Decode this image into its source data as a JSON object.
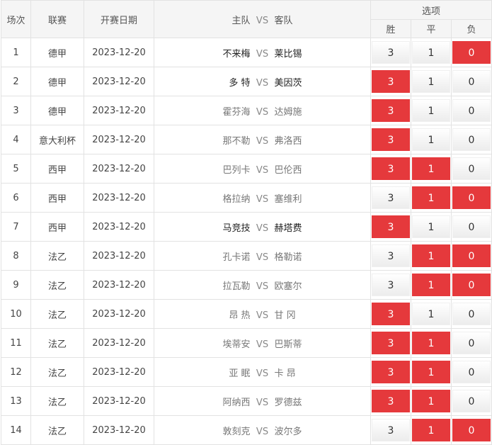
{
  "headers": {
    "index": "场次",
    "league": "联赛",
    "date": "开赛日期",
    "home": "主队",
    "vs": "VS",
    "away": "客队",
    "options": "选项",
    "win": "胜",
    "draw": "平",
    "lose": "负"
  },
  "colors": {
    "selected": "#e5393c"
  },
  "matches": [
    {
      "no": "1",
      "league": "德甲",
      "date": "2023-12-20",
      "home": "不来梅",
      "away": "莱比锡",
      "win": "3",
      "draw": "1",
      "lose": "0",
      "sel": [
        false,
        false,
        true
      ],
      "strong": true
    },
    {
      "no": "2",
      "league": "德甲",
      "date": "2023-12-20",
      "home": "多 特",
      "away": "美因茨",
      "win": "3",
      "draw": "1",
      "lose": "0",
      "sel": [
        true,
        false,
        false
      ],
      "strong": true
    },
    {
      "no": "3",
      "league": "德甲",
      "date": "2023-12-20",
      "home": "霍芬海",
      "away": "达姆施",
      "win": "3",
      "draw": "1",
      "lose": "0",
      "sel": [
        true,
        false,
        false
      ],
      "strong": false
    },
    {
      "no": "4",
      "league": "意大利杯",
      "date": "2023-12-20",
      "home": "那不勒",
      "away": "弗洛西",
      "win": "3",
      "draw": "1",
      "lose": "0",
      "sel": [
        true,
        false,
        false
      ],
      "strong": false
    },
    {
      "no": "5",
      "league": "西甲",
      "date": "2023-12-20",
      "home": "巴列卡",
      "away": "巴伦西",
      "win": "3",
      "draw": "1",
      "lose": "0",
      "sel": [
        true,
        true,
        false
      ],
      "strong": false
    },
    {
      "no": "6",
      "league": "西甲",
      "date": "2023-12-20",
      "home": "格拉纳",
      "away": "塞维利",
      "win": "3",
      "draw": "1",
      "lose": "0",
      "sel": [
        false,
        true,
        true
      ],
      "strong": false
    },
    {
      "no": "7",
      "league": "西甲",
      "date": "2023-12-20",
      "home": "马竞技",
      "away": "赫塔费",
      "win": "3",
      "draw": "1",
      "lose": "0",
      "sel": [
        true,
        false,
        false
      ],
      "strong": true
    },
    {
      "no": "8",
      "league": "法乙",
      "date": "2023-12-20",
      "home": "孔卡诺",
      "away": "格勒诺",
      "win": "3",
      "draw": "1",
      "lose": "0",
      "sel": [
        false,
        true,
        true
      ],
      "strong": false
    },
    {
      "no": "9",
      "league": "法乙",
      "date": "2023-12-20",
      "home": "拉瓦勒",
      "away": "欧塞尔",
      "win": "3",
      "draw": "1",
      "lose": "0",
      "sel": [
        false,
        true,
        true
      ],
      "strong": false
    },
    {
      "no": "10",
      "league": "法乙",
      "date": "2023-12-20",
      "home": "昂 热",
      "away": "甘 冈",
      "win": "3",
      "draw": "1",
      "lose": "0",
      "sel": [
        true,
        false,
        false
      ],
      "strong": false
    },
    {
      "no": "11",
      "league": "法乙",
      "date": "2023-12-20",
      "home": "埃蒂安",
      "away": "巴斯蒂",
      "win": "3",
      "draw": "1",
      "lose": "0",
      "sel": [
        true,
        true,
        false
      ],
      "strong": false
    },
    {
      "no": "12",
      "league": "法乙",
      "date": "2023-12-20",
      "home": "亚 眠",
      "away": "卡 昂",
      "win": "3",
      "draw": "1",
      "lose": "0",
      "sel": [
        true,
        true,
        false
      ],
      "strong": false
    },
    {
      "no": "13",
      "league": "法乙",
      "date": "2023-12-20",
      "home": "阿纳西",
      "away": "罗德兹",
      "win": "3",
      "draw": "1",
      "lose": "0",
      "sel": [
        true,
        true,
        false
      ],
      "strong": false
    },
    {
      "no": "14",
      "league": "法乙",
      "date": "2023-12-20",
      "home": "敦刻克",
      "away": "波尔多",
      "win": "3",
      "draw": "1",
      "lose": "0",
      "sel": [
        false,
        true,
        true
      ],
      "strong": false
    }
  ]
}
